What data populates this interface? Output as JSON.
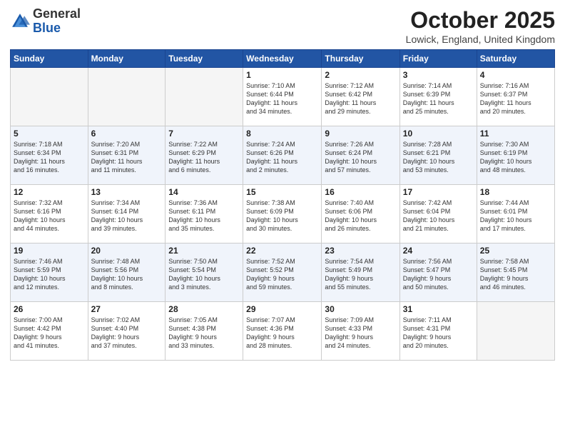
{
  "header": {
    "logo_general": "General",
    "logo_blue": "Blue",
    "month": "October 2025",
    "location": "Lowick, England, United Kingdom"
  },
  "weekdays": [
    "Sunday",
    "Monday",
    "Tuesday",
    "Wednesday",
    "Thursday",
    "Friday",
    "Saturday"
  ],
  "weeks": [
    [
      {
        "day": "",
        "info": ""
      },
      {
        "day": "",
        "info": ""
      },
      {
        "day": "",
        "info": ""
      },
      {
        "day": "1",
        "info": "Sunrise: 7:10 AM\nSunset: 6:44 PM\nDaylight: 11 hours\nand 34 minutes."
      },
      {
        "day": "2",
        "info": "Sunrise: 7:12 AM\nSunset: 6:42 PM\nDaylight: 11 hours\nand 29 minutes."
      },
      {
        "day": "3",
        "info": "Sunrise: 7:14 AM\nSunset: 6:39 PM\nDaylight: 11 hours\nand 25 minutes."
      },
      {
        "day": "4",
        "info": "Sunrise: 7:16 AM\nSunset: 6:37 PM\nDaylight: 11 hours\nand 20 minutes."
      }
    ],
    [
      {
        "day": "5",
        "info": "Sunrise: 7:18 AM\nSunset: 6:34 PM\nDaylight: 11 hours\nand 16 minutes."
      },
      {
        "day": "6",
        "info": "Sunrise: 7:20 AM\nSunset: 6:31 PM\nDaylight: 11 hours\nand 11 minutes."
      },
      {
        "day": "7",
        "info": "Sunrise: 7:22 AM\nSunset: 6:29 PM\nDaylight: 11 hours\nand 6 minutes."
      },
      {
        "day": "8",
        "info": "Sunrise: 7:24 AM\nSunset: 6:26 PM\nDaylight: 11 hours\nand 2 minutes."
      },
      {
        "day": "9",
        "info": "Sunrise: 7:26 AM\nSunset: 6:24 PM\nDaylight: 10 hours\nand 57 minutes."
      },
      {
        "day": "10",
        "info": "Sunrise: 7:28 AM\nSunset: 6:21 PM\nDaylight: 10 hours\nand 53 minutes."
      },
      {
        "day": "11",
        "info": "Sunrise: 7:30 AM\nSunset: 6:19 PM\nDaylight: 10 hours\nand 48 minutes."
      }
    ],
    [
      {
        "day": "12",
        "info": "Sunrise: 7:32 AM\nSunset: 6:16 PM\nDaylight: 10 hours\nand 44 minutes."
      },
      {
        "day": "13",
        "info": "Sunrise: 7:34 AM\nSunset: 6:14 PM\nDaylight: 10 hours\nand 39 minutes."
      },
      {
        "day": "14",
        "info": "Sunrise: 7:36 AM\nSunset: 6:11 PM\nDaylight: 10 hours\nand 35 minutes."
      },
      {
        "day": "15",
        "info": "Sunrise: 7:38 AM\nSunset: 6:09 PM\nDaylight: 10 hours\nand 30 minutes."
      },
      {
        "day": "16",
        "info": "Sunrise: 7:40 AM\nSunset: 6:06 PM\nDaylight: 10 hours\nand 26 minutes."
      },
      {
        "day": "17",
        "info": "Sunrise: 7:42 AM\nSunset: 6:04 PM\nDaylight: 10 hours\nand 21 minutes."
      },
      {
        "day": "18",
        "info": "Sunrise: 7:44 AM\nSunset: 6:01 PM\nDaylight: 10 hours\nand 17 minutes."
      }
    ],
    [
      {
        "day": "19",
        "info": "Sunrise: 7:46 AM\nSunset: 5:59 PM\nDaylight: 10 hours\nand 12 minutes."
      },
      {
        "day": "20",
        "info": "Sunrise: 7:48 AM\nSunset: 5:56 PM\nDaylight: 10 hours\nand 8 minutes."
      },
      {
        "day": "21",
        "info": "Sunrise: 7:50 AM\nSunset: 5:54 PM\nDaylight: 10 hours\nand 3 minutes."
      },
      {
        "day": "22",
        "info": "Sunrise: 7:52 AM\nSunset: 5:52 PM\nDaylight: 9 hours\nand 59 minutes."
      },
      {
        "day": "23",
        "info": "Sunrise: 7:54 AM\nSunset: 5:49 PM\nDaylight: 9 hours\nand 55 minutes."
      },
      {
        "day": "24",
        "info": "Sunrise: 7:56 AM\nSunset: 5:47 PM\nDaylight: 9 hours\nand 50 minutes."
      },
      {
        "day": "25",
        "info": "Sunrise: 7:58 AM\nSunset: 5:45 PM\nDaylight: 9 hours\nand 46 minutes."
      }
    ],
    [
      {
        "day": "26",
        "info": "Sunrise: 7:00 AM\nSunset: 4:42 PM\nDaylight: 9 hours\nand 41 minutes."
      },
      {
        "day": "27",
        "info": "Sunrise: 7:02 AM\nSunset: 4:40 PM\nDaylight: 9 hours\nand 37 minutes."
      },
      {
        "day": "28",
        "info": "Sunrise: 7:05 AM\nSunset: 4:38 PM\nDaylight: 9 hours\nand 33 minutes."
      },
      {
        "day": "29",
        "info": "Sunrise: 7:07 AM\nSunset: 4:36 PM\nDaylight: 9 hours\nand 28 minutes."
      },
      {
        "day": "30",
        "info": "Sunrise: 7:09 AM\nSunset: 4:33 PM\nDaylight: 9 hours\nand 24 minutes."
      },
      {
        "day": "31",
        "info": "Sunrise: 7:11 AM\nSunset: 4:31 PM\nDaylight: 9 hours\nand 20 minutes."
      },
      {
        "day": "",
        "info": ""
      }
    ]
  ]
}
